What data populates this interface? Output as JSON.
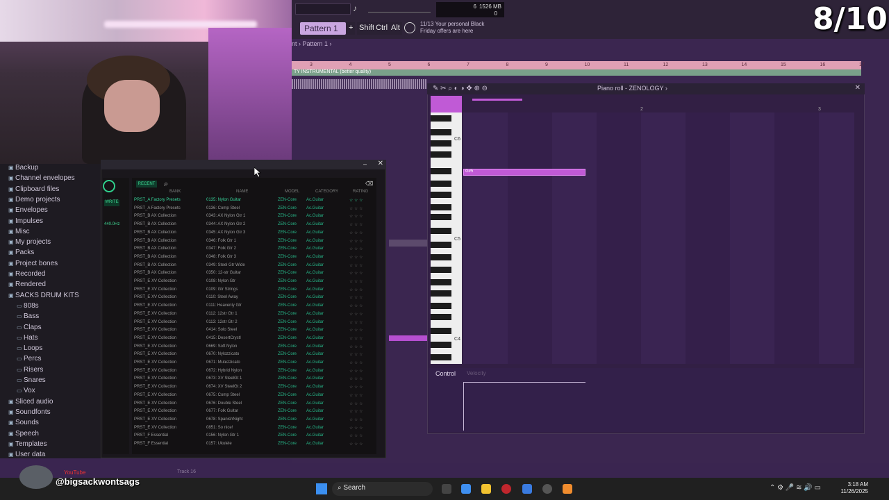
{
  "overlay": {
    "score": "8/10",
    "handle": "@bigsackwontsags",
    "yt_label": "YouTube"
  },
  "topbar": {
    "pattern": "Pattern 1",
    "plus": "+",
    "shift": "Shift",
    "ctrl": "Ctrl",
    "alt": "Alt",
    "promo_line1": "11/13  Your personal Black",
    "promo_line2": "Friday offers are here",
    "cpu": "6",
    "mem": "1526 MB",
    "poly": "0"
  },
  "playlist": {
    "breadcrumb": "nt  ›  Pattern 1  ›",
    "ruler": [
      "3",
      "4",
      "5",
      "6",
      "7",
      "8",
      "9",
      "10",
      "11",
      "12",
      "13",
      "14",
      "15",
      "16",
      "17"
    ],
    "track": "TY INSTRUMENTAL (better quality)"
  },
  "pianoroll": {
    "title": "Piano roll - ZENOLOGY  ›",
    "keys": [
      "C6",
      "C5",
      "C4"
    ],
    "note": "G#5",
    "bar2": "2",
    "bar3": "3",
    "control": "Control",
    "velocity": "Velocity"
  },
  "browser": {
    "items": [
      {
        "label": "Backup",
        "sub": false
      },
      {
        "label": "Channel envelopes",
        "sub": false
      },
      {
        "label": "Clipboard files",
        "sub": false
      },
      {
        "label": "Demo projects",
        "sub": false
      },
      {
        "label": "Envelopes",
        "sub": false
      },
      {
        "label": "Impulses",
        "sub": false
      },
      {
        "label": "Misc",
        "sub": false
      },
      {
        "label": "My projects",
        "sub": false
      },
      {
        "label": "Packs",
        "sub": false
      },
      {
        "label": "Project bones",
        "sub": false
      },
      {
        "label": "Recorded",
        "sub": false
      },
      {
        "label": "Rendered",
        "sub": false
      },
      {
        "label": "SACKS DRUM KITS",
        "sub": false
      },
      {
        "label": "808s",
        "sub": true
      },
      {
        "label": "Bass",
        "sub": true
      },
      {
        "label": "Claps",
        "sub": true
      },
      {
        "label": "Hats",
        "sub": true
      },
      {
        "label": "Loops",
        "sub": true
      },
      {
        "label": "Percs",
        "sub": true
      },
      {
        "label": "Risers",
        "sub": true
      },
      {
        "label": "Snares",
        "sub": true
      },
      {
        "label": "Vox",
        "sub": true
      },
      {
        "label": "Sliced audio",
        "sub": false
      },
      {
        "label": "Soundfonts",
        "sub": false
      },
      {
        "label": "Sounds",
        "sub": false
      },
      {
        "label": "Speech",
        "sub": false
      },
      {
        "label": "Templates",
        "sub": false
      },
      {
        "label": "User data",
        "sub": false
      }
    ]
  },
  "plugin": {
    "recent": "RECENT",
    "write": "WRITE",
    "freq": "440.0Hz",
    "headers": [
      "BANK",
      "NAME",
      "MODEL",
      "CATEGORY",
      "RATING"
    ],
    "rows": [
      [
        "PRST_A Factory Presets",
        "0135: Nylon Guitar",
        "ZEN-Core",
        "Ac.Guitar"
      ],
      [
        "PRST_A Factory Presets",
        "0136: Comp Steel",
        "ZEN-Core",
        "Ac.Guitar"
      ],
      [
        "PRST_B AX Collection",
        "0343: AX Nylon Gtr 1",
        "ZEN-Core",
        "Ac.Guitar"
      ],
      [
        "PRST_B AX Collection",
        "0344: AX Nylon Gtr 2",
        "ZEN-Core",
        "Ac.Guitar"
      ],
      [
        "PRST_B AX Collection",
        "0345: AX Nylon Gtr 3",
        "ZEN-Core",
        "Ac.Guitar"
      ],
      [
        "PRST_B AX Collection",
        "0346: Folk Gtr 1",
        "ZEN-Core",
        "Ac.Guitar"
      ],
      [
        "PRST_B AX Collection",
        "0347: Folk Gtr 2",
        "ZEN-Core",
        "Ac.Guitar"
      ],
      [
        "PRST_B AX Collection",
        "0348: Folk Gtr 3",
        "ZEN-Core",
        "Ac.Guitar"
      ],
      [
        "PRST_B AX Collection",
        "0349: Steel Gtr Wide",
        "ZEN-Core",
        "Ac.Guitar"
      ],
      [
        "PRST_B AX Collection",
        "0350: 12-str Guitar",
        "ZEN-Core",
        "Ac.Guitar"
      ],
      [
        "PRST_E XV Collection",
        "0108: Nylon Gtr",
        "ZEN-Core",
        "Ac.Guitar"
      ],
      [
        "PRST_E XV Collection",
        "0109: Gtr Strings",
        "ZEN-Core",
        "Ac.Guitar"
      ],
      [
        "PRST_E XV Collection",
        "0110: Steel Away",
        "ZEN-Core",
        "Ac.Guitar"
      ],
      [
        "PRST_E XV Collection",
        "0111: Heavenly Gtr",
        "ZEN-Core",
        "Ac.Guitar"
      ],
      [
        "PRST_E XV Collection",
        "0112: 12str Gtr 1",
        "ZEN-Core",
        "Ac.Guitar"
      ],
      [
        "PRST_E XV Collection",
        "0113: 12str Gtr 2",
        "ZEN-Core",
        "Ac.Guitar"
      ],
      [
        "PRST_E XV Collection",
        "0414: Solo Steel",
        "ZEN-Core",
        "Ac.Guitar"
      ],
      [
        "PRST_E XV Collection",
        "0415: DesertCrystl",
        "ZEN-Core",
        "Ac.Guitar"
      ],
      [
        "PRST_E XV Collection",
        "0669: Soft Nylon",
        "ZEN-Core",
        "Ac.Guitar"
      ],
      [
        "PRST_E XV Collection",
        "0670: Nylozzicato",
        "ZEN-Core",
        "Ac.Guitar"
      ],
      [
        "PRST_E XV Collection",
        "0671: Mutezzicato",
        "ZEN-Core",
        "Ac.Guitar"
      ],
      [
        "PRST_E XV Collection",
        "0672: Hybrid Nylon",
        "ZEN-Core",
        "Ac.Guitar"
      ],
      [
        "PRST_E XV Collection",
        "0673: XV SteelGt 1",
        "ZEN-Core",
        "Ac.Guitar"
      ],
      [
        "PRST_E XV Collection",
        "0674: XV SteelGt 2",
        "ZEN-Core",
        "Ac.Guitar"
      ],
      [
        "PRST_E XV Collection",
        "0675: Comp Steel",
        "ZEN-Core",
        "Ac.Guitar"
      ],
      [
        "PRST_E XV Collection",
        "0676: Double Steel",
        "ZEN-Core",
        "Ac.Guitar"
      ],
      [
        "PRST_E XV Collection",
        "0677: Folk Guitar",
        "ZEN-Core",
        "Ac.Guitar"
      ],
      [
        "PRST_E XV Collection",
        "0678: SpanishNight",
        "ZEN-Core",
        "Ac.Guitar"
      ],
      [
        "PRST_E XV Collection",
        "0851: So nice!",
        "ZEN-Core",
        "Ac.Guitar"
      ],
      [
        "PRST_F Essential",
        "0156: Nylon Gtr 1",
        "ZEN-Core",
        "Ac.Guitar"
      ],
      [
        "PRST_F Essential",
        "0157: Ukulele",
        "ZEN-Core",
        "Ac.Guitar"
      ]
    ],
    "stars": "☆ ☆ ☆"
  },
  "taskbar": {
    "search": "Search",
    "time": "3:18 AM",
    "date": "11/26/2025",
    "track": "Track 16"
  }
}
